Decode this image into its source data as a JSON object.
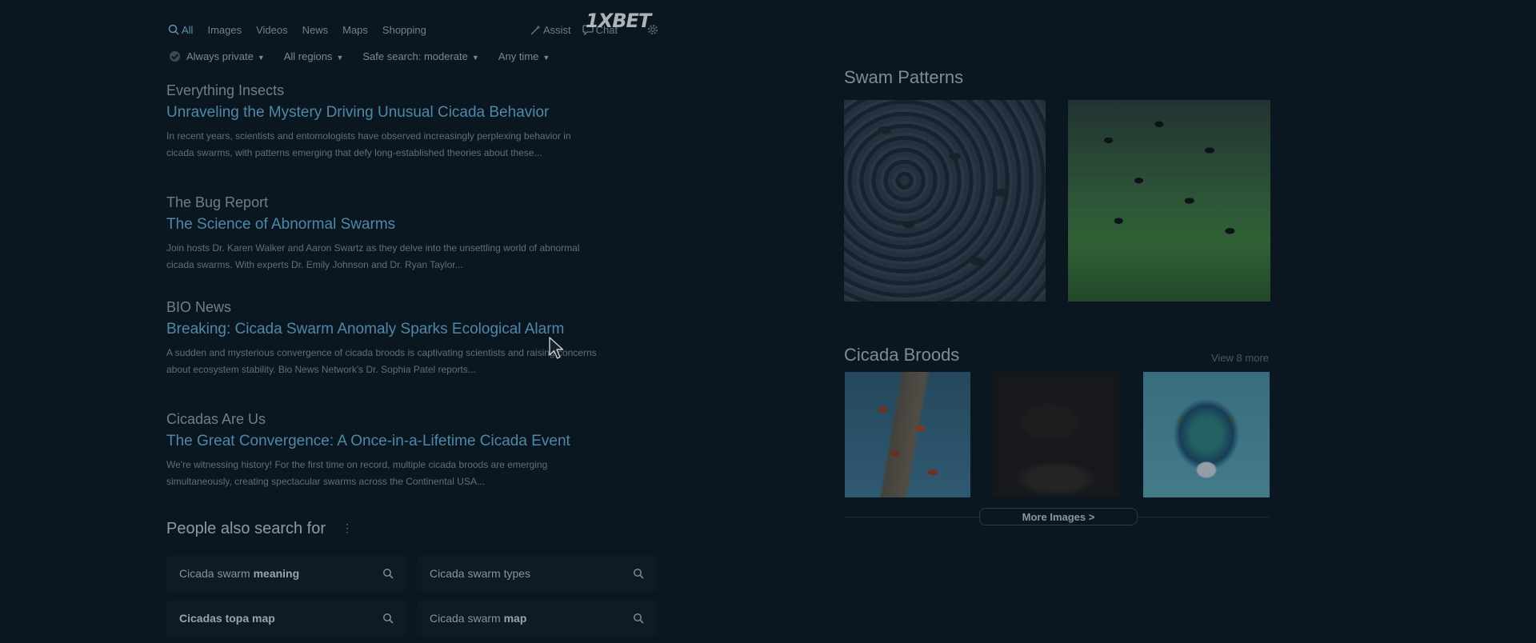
{
  "nav": {
    "tabs": [
      {
        "label": "All",
        "icon": "search-icon",
        "active": true
      },
      {
        "label": "Images"
      },
      {
        "label": "Videos"
      },
      {
        "label": "News"
      },
      {
        "label": "Maps"
      },
      {
        "label": "Shopping"
      }
    ],
    "assist_label": "Assist",
    "chat_label": "Chat",
    "watermark": "1XBET"
  },
  "filters": {
    "privacy": "Always private",
    "region": "All regions",
    "safe_search": "Safe search: moderate",
    "time": "Any time"
  },
  "results": [
    {
      "source": "Everything Insects",
      "title": "Unraveling the Mystery Driving Unusual Cicada Behavior",
      "snippet": "In recent years, scientists and entomologists have observed increasingly perplexing behavior in cicada swarms, with patterns emerging that defy long-established theories about these..."
    },
    {
      "source": "The Bug Report",
      "title": "The Science of Abnormal Swarms",
      "snippet": "Join hosts Dr. Karen Walker and Aaron Swartz as they delve into the unsettling world of abnormal cicada swarms. With experts Dr. Emily Johnson and Dr. Ryan Taylor..."
    },
    {
      "source": "BIO News",
      "title": "Breaking: Cicada Swarm Anomaly Sparks Ecological Alarm",
      "snippet": "A sudden and mysterious convergence of cicada broods is captivating scientists and raising concerns about ecosystem stability. Bio News Network's Dr. Sophia Patel reports..."
    },
    {
      "source": "Cicadas Are Us",
      "title": "The Great Convergence: A Once-in-a-Lifetime Cicada Event",
      "snippet": "We're witnessing history! For the first time on record, multiple cicada broods are emerging simultaneously, creating spectacular swarms across the Continental USA..."
    }
  ],
  "people_also_search": {
    "title": "People also search for",
    "items": [
      {
        "prefix": "Cicada swarm ",
        "bold": "meaning"
      },
      {
        "prefix": "Cicada swarm types",
        "bold": ""
      },
      {
        "prefix": "",
        "bold": "Cicadas topa  map"
      },
      {
        "prefix": "Cicada swarm ",
        "bold": "map"
      }
    ]
  },
  "sidebar": {
    "swarm_title": "Swam Patterns",
    "broods_title": "Cicada Broods",
    "view_more": "View 8 more",
    "more_images": "More Images >"
  },
  "colors": {
    "background": "#0b1720",
    "link": "#4f87a8",
    "active_tab": "#5f8fb0"
  }
}
